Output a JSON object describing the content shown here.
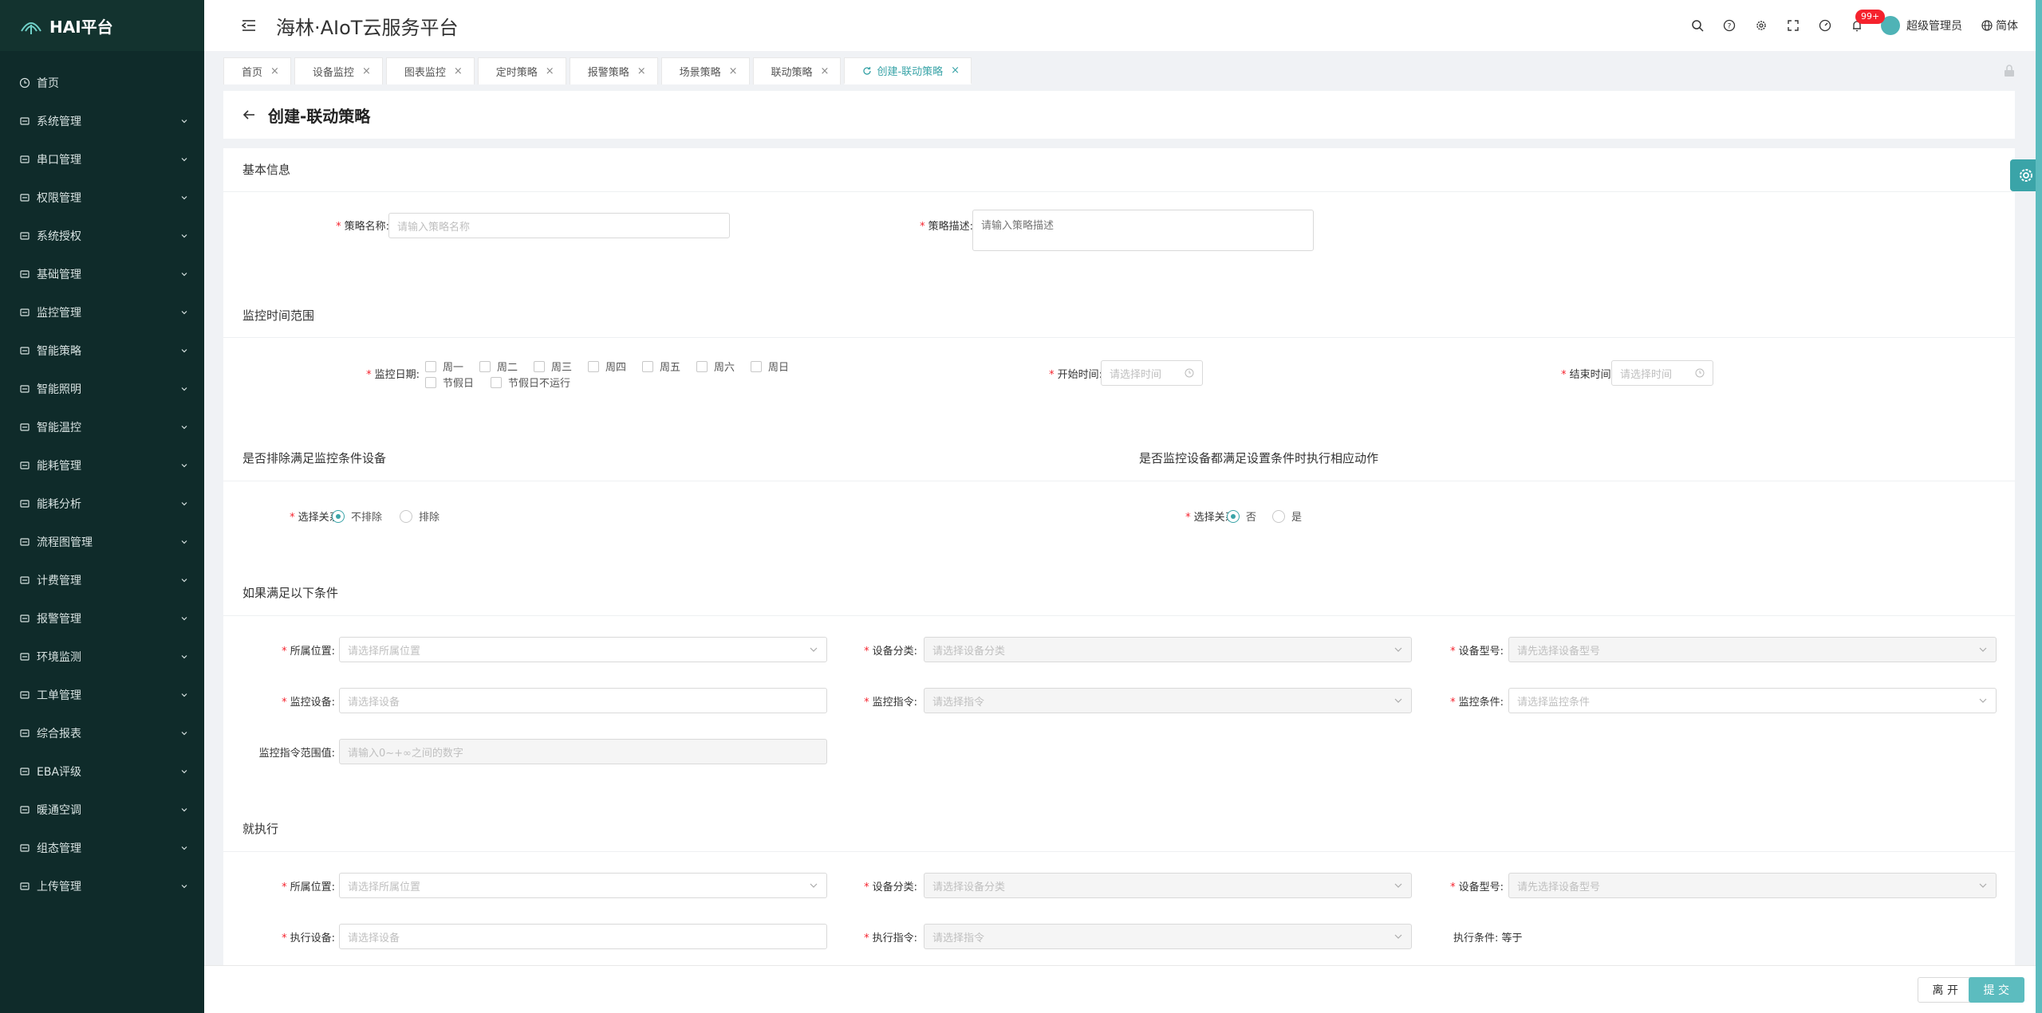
{
  "sidebar": {
    "logo": "HAI平台",
    "items": [
      {
        "label": "首页",
        "icon": "clock-icon",
        "has_children": false
      },
      {
        "label": "系统管理",
        "icon": "monitor-icon",
        "has_children": true
      },
      {
        "label": "串口管理",
        "icon": "sliders-icon",
        "has_children": true
      },
      {
        "label": "权限管理",
        "icon": "shield-icon",
        "has_children": true
      },
      {
        "label": "系统授权",
        "icon": "key-icon",
        "has_children": true
      },
      {
        "label": "基础管理",
        "icon": "box-icon",
        "has_children": true
      },
      {
        "label": "监控管理",
        "icon": "screen-icon",
        "has_children": true
      },
      {
        "label": "智能策略",
        "icon": "pin-icon",
        "has_children": true
      },
      {
        "label": "智能照明",
        "icon": "bulb-icon",
        "has_children": true
      },
      {
        "label": "智能温控",
        "icon": "thermo-icon",
        "has_children": true
      },
      {
        "label": "能耗管理",
        "icon": "sliders-icon",
        "has_children": true
      },
      {
        "label": "能耗分析",
        "icon": "bar-chart-icon",
        "has_children": true
      },
      {
        "label": "流程图管理",
        "icon": "flow-icon",
        "has_children": true
      },
      {
        "label": "计费管理",
        "icon": "wallet-icon",
        "has_children": true
      },
      {
        "label": "报警管理",
        "icon": "alarm-icon",
        "has_children": true
      },
      {
        "label": "环境监测",
        "icon": "leaf-icon",
        "has_children": true
      },
      {
        "label": "工单管理",
        "icon": "layers-icon",
        "has_children": true
      },
      {
        "label": "综合报表",
        "icon": "report-icon",
        "has_children": true
      },
      {
        "label": "EBA评级",
        "icon": "doc-icon",
        "has_children": true
      },
      {
        "label": "暖通空调",
        "icon": "fan-icon",
        "has_children": true
      },
      {
        "label": "组态管理",
        "icon": "gear-icon",
        "has_children": true
      },
      {
        "label": "上传管理",
        "icon": "cloud-upload-icon",
        "has_children": true
      }
    ]
  },
  "header": {
    "title": "海林·AIoT云服务平台",
    "notification_count": "99+",
    "user_name": "超级管理员",
    "language": "简体"
  },
  "tabs": [
    {
      "label": "首页",
      "active": false
    },
    {
      "label": "设备监控",
      "active": false
    },
    {
      "label": "图表监控",
      "active": false
    },
    {
      "label": "定时策略",
      "active": false
    },
    {
      "label": "报警策略",
      "active": false
    },
    {
      "label": "场景策略",
      "active": false
    },
    {
      "label": "联动策略",
      "active": false
    },
    {
      "label": "创建-联动策略",
      "active": true
    }
  ],
  "page": {
    "title": "创建-联动策略"
  },
  "basic": {
    "section_title": "基本信息",
    "name_label": "策略名称:",
    "name_placeholder": "请输入策略名称",
    "desc_label": "策略描述:",
    "desc_placeholder": "请输入策略描述"
  },
  "time_range": {
    "section_title": "监控时间范围",
    "date_label": "监控日期:",
    "days": [
      "周一",
      "周二",
      "周三",
      "周四",
      "周五",
      "周六",
      "周日"
    ],
    "holiday": "节假日",
    "holiday_skip": "节假日不运行",
    "start_label": "开始时间:",
    "start_placeholder": "请选择时间",
    "end_label": "结束时间:",
    "end_placeholder": "请选择时间"
  },
  "exclude": {
    "section_title": "是否排除满足监控条件设备",
    "relation_label": "选择关系:",
    "options": [
      "不排除",
      "排除"
    ],
    "selected": "不排除"
  },
  "all_meet": {
    "section_title": "是否监控设备都满足设置条件时执行相应动作",
    "relation_label": "选择关系:",
    "options": [
      "否",
      "是"
    ],
    "selected": "否"
  },
  "condition": {
    "section_title": "如果满足以下条件",
    "location_label": "所属位置:",
    "location_placeholder": "请选择所属位置",
    "category_label": "设备分类:",
    "category_placeholder": "请选择设备分类",
    "model_label": "设备型号:",
    "model_placeholder": "请先选择设备型号",
    "device_label": "监控设备:",
    "device_placeholder": "请选择设备",
    "command_label": "监控指令:",
    "command_placeholder": "请选择指令",
    "cond_label": "监控条件:",
    "cond_placeholder": "请选择监控条件",
    "range_label": "监控指令范围值:",
    "range_placeholder": "请输入0~+∞之间的数字"
  },
  "execute": {
    "section_title": "就执行",
    "location_label": "所属位置:",
    "location_placeholder": "请选择所属位置",
    "category_label": "设备分类:",
    "category_placeholder": "请选择设备分类",
    "model_label": "设备型号:",
    "model_placeholder": "请先选择设备型号",
    "device_label": "执行设备:",
    "device_placeholder": "请选择设备",
    "command_label": "执行指令:",
    "command_placeholder": "请选择指令",
    "cond_text": "执行条件: 等于"
  },
  "footer": {
    "leave": "离 开",
    "submit": "提 交"
  },
  "colors": {
    "sidebar_bg": "#0f2b2a",
    "accent": "#3aa4a8",
    "badge": "#f5222d"
  }
}
